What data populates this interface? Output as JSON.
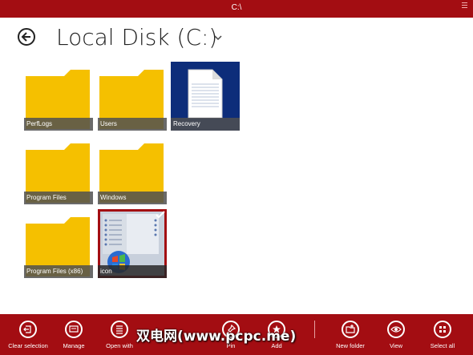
{
  "window": {
    "title": "C:\\"
  },
  "header": {
    "title": "Local Disk (C:)"
  },
  "items": [
    {
      "name": "PerfLogs",
      "type": "folder"
    },
    {
      "name": "Users",
      "type": "folder"
    },
    {
      "name": "Recovery",
      "type": "file"
    },
    {
      "name": "Program Files",
      "type": "folder"
    },
    {
      "name": "Windows",
      "type": "folder"
    },
    {
      "name": "Program Files (x86)",
      "type": "folder"
    },
    {
      "name": "icon",
      "type": "image",
      "selected": true
    }
  ],
  "appbar": {
    "commands": [
      {
        "label": "Clear selection",
        "icon": "clear-selection-icon"
      },
      {
        "label": "Manage",
        "icon": "manage-icon"
      },
      {
        "label": "Open with",
        "icon": "open-with-icon"
      },
      {
        "label": "Pin",
        "icon": "pin-icon"
      },
      {
        "label": "Add",
        "icon": "add-icon"
      },
      {
        "label": "New folder",
        "icon": "new-folder-icon"
      },
      {
        "label": "View",
        "icon": "view-icon"
      },
      {
        "label": "Select all",
        "icon": "select-all-icon"
      }
    ]
  },
  "watermark": "双电网(www.pcpc.me)",
  "colors": {
    "accent": "#a30d12",
    "folder": "#f5c000",
    "recovery_tile": "#0d2d7a"
  }
}
